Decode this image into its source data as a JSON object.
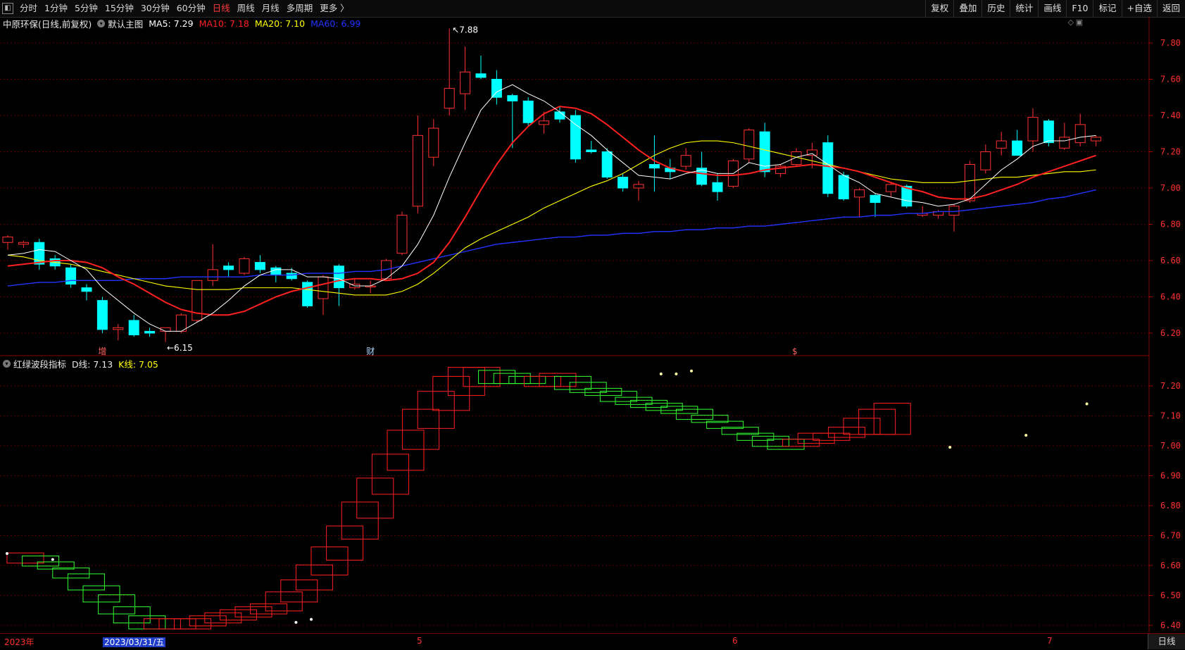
{
  "toolbar": {
    "left_icon": "panel-toggle-icon",
    "periods": [
      "分时",
      "1分钟",
      "5分钟",
      "15分钟",
      "30分钟",
      "60分钟",
      "日线",
      "周线",
      "月线",
      "多周期",
      "更多 〉"
    ],
    "active_period": "日线",
    "right_buttons": [
      "复权",
      "叠加",
      "历史",
      "统计",
      "画线",
      "F10",
      "标记",
      "+自选",
      "返回"
    ]
  },
  "main_chart": {
    "title": "中原环保(日线,前复权)",
    "indicator_name": "默认主图",
    "ma": [
      {
        "label": "MA5: 7.29",
        "color": "#ffffff"
      },
      {
        "label": "MA10: 7.18",
        "color": "#ff2020"
      },
      {
        "label": "MA20: 7.10",
        "color": "#ffff00"
      },
      {
        "label": "MA60: 6.99",
        "color": "#2233ff"
      }
    ],
    "y_ticks": [
      "7.80",
      "7.60",
      "7.40",
      "7.20",
      "7.00",
      "6.80",
      "6.60",
      "6.40",
      "6.20"
    ],
    "high_label": "7.88",
    "low_label": "6.15",
    "markers": [
      "增",
      "财",
      "$"
    ],
    "colors": {
      "up": "#ff3030",
      "down": "#00ffff"
    }
  },
  "sub_chart": {
    "name": "红绿波段指标",
    "d_label": "D线: 7.13",
    "k_label": "K线: 7.05",
    "y_ticks": [
      "7.20",
      "7.10",
      "7.00",
      "6.90",
      "6.80",
      "6.70",
      "6.60",
      "6.50",
      "6.40"
    ],
    "colors": {
      "up": "#ff2020",
      "down": "#33ff33"
    }
  },
  "bottom": {
    "dates": [
      "2023年",
      "2023/03/31/五",
      "5",
      "6",
      "7"
    ],
    "mode_button": "日线"
  },
  "chart_data": {
    "type": "candlestick",
    "days": 70,
    "candles": [
      {
        "o": 6.7,
        "h": 6.74,
        "l": 6.66,
        "c": 6.73
      },
      {
        "o": 6.69,
        "h": 6.71,
        "l": 6.67,
        "c": 6.7
      },
      {
        "o": 6.7,
        "h": 6.72,
        "l": 6.55,
        "c": 6.58
      },
      {
        "o": 6.61,
        "h": 6.63,
        "l": 6.55,
        "c": 6.57
      },
      {
        "o": 6.56,
        "h": 6.58,
        "l": 6.45,
        "c": 6.47
      },
      {
        "o": 6.45,
        "h": 6.47,
        "l": 6.38,
        "c": 6.43
      },
      {
        "o": 6.38,
        "h": 6.4,
        "l": 6.2,
        "c": 6.22
      },
      {
        "o": 6.22,
        "h": 6.25,
        "l": 6.16,
        "c": 6.23
      },
      {
        "o": 6.27,
        "h": 6.3,
        "l": 6.18,
        "c": 6.19
      },
      {
        "o": 6.21,
        "h": 6.23,
        "l": 6.18,
        "c": 6.2
      },
      {
        "o": 6.21,
        "h": 6.23,
        "l": 6.15,
        "c": 6.23
      },
      {
        "o": 6.21,
        "h": 6.31,
        "l": 6.2,
        "c": 6.3
      },
      {
        "o": 6.27,
        "h": 6.49,
        "l": 6.26,
        "c": 6.49
      },
      {
        "o": 6.49,
        "h": 6.69,
        "l": 6.46,
        "c": 6.55
      },
      {
        "o": 6.57,
        "h": 6.59,
        "l": 6.51,
        "c": 6.55
      },
      {
        "o": 6.53,
        "h": 6.62,
        "l": 6.52,
        "c": 6.61
      },
      {
        "o": 6.59,
        "h": 6.63,
        "l": 6.53,
        "c": 6.55
      },
      {
        "o": 6.56,
        "h": 6.57,
        "l": 6.48,
        "c": 6.52
      },
      {
        "o": 6.53,
        "h": 6.56,
        "l": 6.49,
        "c": 6.5
      },
      {
        "o": 6.48,
        "h": 6.49,
        "l": 6.34,
        "c": 6.35
      },
      {
        "o": 6.39,
        "h": 6.52,
        "l": 6.3,
        "c": 6.51
      },
      {
        "o": 6.57,
        "h": 6.58,
        "l": 6.35,
        "c": 6.45
      },
      {
        "o": 6.45,
        "h": 6.5,
        "l": 6.44,
        "c": 6.47
      },
      {
        "o": 6.46,
        "h": 6.49,
        "l": 6.42,
        "c": 6.46
      },
      {
        "o": 6.5,
        "h": 6.61,
        "l": 6.49,
        "c": 6.6
      },
      {
        "o": 6.64,
        "h": 6.87,
        "l": 6.63,
        "c": 6.85
      },
      {
        "o": 6.9,
        "h": 7.4,
        "l": 6.86,
        "c": 7.29
      },
      {
        "o": 7.17,
        "h": 7.38,
        "l": 7.12,
        "c": 7.33
      },
      {
        "o": 7.44,
        "h": 7.88,
        "l": 7.4,
        "c": 7.55
      },
      {
        "o": 7.52,
        "h": 7.78,
        "l": 7.43,
        "c": 7.64
      },
      {
        "o": 7.63,
        "h": 7.73,
        "l": 7.6,
        "c": 7.61
      },
      {
        "o": 7.6,
        "h": 7.65,
        "l": 7.46,
        "c": 7.5
      },
      {
        "o": 7.51,
        "h": 7.52,
        "l": 7.22,
        "c": 7.48
      },
      {
        "o": 7.48,
        "h": 7.5,
        "l": 7.34,
        "c": 7.36
      },
      {
        "o": 7.35,
        "h": 7.42,
        "l": 7.3,
        "c": 7.37
      },
      {
        "o": 7.42,
        "h": 7.45,
        "l": 7.36,
        "c": 7.38
      },
      {
        "o": 7.4,
        "h": 7.43,
        "l": 7.14,
        "c": 7.16
      },
      {
        "o": 7.21,
        "h": 7.26,
        "l": 7.19,
        "c": 7.2
      },
      {
        "o": 7.2,
        "h": 7.22,
        "l": 7.05,
        "c": 7.06
      },
      {
        "o": 7.06,
        "h": 7.08,
        "l": 6.98,
        "c": 7.0
      },
      {
        "o": 7.0,
        "h": 7.04,
        "l": 6.93,
        "c": 7.02
      },
      {
        "o": 7.13,
        "h": 7.29,
        "l": 6.98,
        "c": 7.11
      },
      {
        "o": 7.11,
        "h": 7.16,
        "l": 7.05,
        "c": 7.09
      },
      {
        "o": 7.12,
        "h": 7.22,
        "l": 7.1,
        "c": 7.18
      },
      {
        "o": 7.11,
        "h": 7.2,
        "l": 7.01,
        "c": 7.02
      },
      {
        "o": 7.03,
        "h": 7.08,
        "l": 6.93,
        "c": 6.98
      },
      {
        "o": 7.01,
        "h": 7.16,
        "l": 7.0,
        "c": 7.15
      },
      {
        "o": 7.16,
        "h": 7.33,
        "l": 7.14,
        "c": 7.32
      },
      {
        "o": 7.31,
        "h": 7.36,
        "l": 7.06,
        "c": 7.09
      },
      {
        "o": 7.08,
        "h": 7.13,
        "l": 7.06,
        "c": 7.12
      },
      {
        "o": 7.13,
        "h": 7.22,
        "l": 7.12,
        "c": 7.2
      },
      {
        "o": 7.18,
        "h": 7.25,
        "l": 7.11,
        "c": 7.21
      },
      {
        "o": 7.25,
        "h": 7.29,
        "l": 6.95,
        "c": 6.97
      },
      {
        "o": 7.07,
        "h": 7.09,
        "l": 6.93,
        "c": 6.94
      },
      {
        "o": 6.95,
        "h": 7.0,
        "l": 6.84,
        "c": 6.99
      },
      {
        "o": 6.96,
        "h": 6.97,
        "l": 6.84,
        "c": 6.92
      },
      {
        "o": 6.98,
        "h": 7.03,
        "l": 6.95,
        "c": 7.02
      },
      {
        "o": 7.01,
        "h": 7.02,
        "l": 6.89,
        "c": 6.9
      },
      {
        "o": 6.85,
        "h": 6.9,
        "l": 6.84,
        "c": 6.86
      },
      {
        "o": 6.85,
        "h": 6.88,
        "l": 6.83,
        "c": 6.87
      },
      {
        "o": 6.85,
        "h": 6.91,
        "l": 6.76,
        "c": 6.9
      },
      {
        "o": 6.93,
        "h": 7.15,
        "l": 6.92,
        "c": 7.13
      },
      {
        "o": 7.1,
        "h": 7.24,
        "l": 7.08,
        "c": 7.2
      },
      {
        "o": 7.22,
        "h": 7.31,
        "l": 7.18,
        "c": 7.26
      },
      {
        "o": 7.26,
        "h": 7.32,
        "l": 7.2,
        "c": 7.18
      },
      {
        "o": 7.26,
        "h": 7.44,
        "l": 7.2,
        "c": 7.39
      },
      {
        "o": 7.37,
        "h": 7.38,
        "l": 7.23,
        "c": 7.25
      },
      {
        "o": 7.22,
        "h": 7.36,
        "l": 7.21,
        "c": 7.28
      },
      {
        "o": 7.25,
        "h": 7.41,
        "l": 7.23,
        "c": 7.35
      },
      {
        "o": 7.26,
        "h": 7.29,
        "l": 7.23,
        "c": 7.28
      }
    ],
    "ma5": [
      6.63,
      6.64,
      6.66,
      6.65,
      6.6,
      6.55,
      6.45,
      6.38,
      6.31,
      6.25,
      6.21,
      6.21,
      6.26,
      6.31,
      6.38,
      6.46,
      6.52,
      6.55,
      6.55,
      6.51,
      6.51,
      6.5,
      6.46,
      6.46,
      6.5,
      6.57,
      6.69,
      6.85,
      7.06,
      7.25,
      7.43,
      7.53,
      7.57,
      7.52,
      7.48,
      7.42,
      7.35,
      7.29,
      7.21,
      7.14,
      7.07,
      7.06,
      7.05,
      7.08,
      7.1,
      7.08,
      7.08,
      7.14,
      7.12,
      7.13,
      7.17,
      7.19,
      7.13,
      7.07,
      7.03,
      6.97,
      6.95,
      6.93,
      6.92,
      6.9,
      6.91,
      6.94,
      7.02,
      7.1,
      7.16,
      7.23,
      7.26,
      7.26,
      7.28,
      7.29
    ],
    "ma10": [
      6.57,
      6.58,
      6.59,
      6.6,
      6.6,
      6.59,
      6.56,
      6.51,
      6.47,
      6.42,
      6.37,
      6.33,
      6.31,
      6.3,
      6.3,
      6.32,
      6.36,
      6.4,
      6.43,
      6.45,
      6.47,
      6.49,
      6.5,
      6.5,
      6.49,
      6.5,
      6.53,
      6.59,
      6.7,
      6.84,
      6.99,
      7.13,
      7.25,
      7.34,
      7.41,
      7.45,
      7.44,
      7.41,
      7.35,
      7.28,
      7.21,
      7.15,
      7.11,
      7.09,
      7.08,
      7.07,
      7.07,
      7.08,
      7.1,
      7.11,
      7.12,
      7.13,
      7.12,
      7.11,
      7.09,
      7.06,
      7.03,
      7.0,
      6.98,
      6.95,
      6.94,
      6.94,
      6.96,
      6.99,
      7.02,
      7.06,
      7.09,
      7.12,
      7.15,
      7.18
    ],
    "ma20": [
      6.63,
      6.62,
      6.6,
      6.59,
      6.58,
      6.56,
      6.54,
      6.52,
      6.5,
      6.48,
      6.46,
      6.45,
      6.44,
      6.44,
      6.44,
      6.45,
      6.45,
      6.45,
      6.45,
      6.44,
      6.43,
      6.42,
      6.41,
      6.41,
      6.41,
      6.43,
      6.47,
      6.53,
      6.6,
      6.67,
      6.72,
      6.76,
      6.8,
      6.84,
      6.89,
      6.93,
      6.97,
      7.01,
      7.04,
      7.08,
      7.13,
      7.18,
      7.22,
      7.25,
      7.26,
      7.26,
      7.25,
      7.23,
      7.21,
      7.19,
      7.17,
      7.15,
      7.13,
      7.11,
      7.09,
      7.07,
      7.05,
      7.04,
      7.03,
      7.03,
      7.03,
      7.04,
      7.05,
      7.06,
      7.06,
      7.07,
      7.08,
      7.09,
      7.09,
      7.1
    ],
    "ma60": [
      6.46,
      6.47,
      6.48,
      6.48,
      6.49,
      6.49,
      6.49,
      6.49,
      6.5,
      6.5,
      6.5,
      6.51,
      6.51,
      6.51,
      6.51,
      6.51,
      6.52,
      6.52,
      6.52,
      6.53,
      6.53,
      6.53,
      6.54,
      6.54,
      6.55,
      6.57,
      6.59,
      6.61,
      6.63,
      6.65,
      6.67,
      6.69,
      6.7,
      6.71,
      6.72,
      6.73,
      6.73,
      6.74,
      6.74,
      6.75,
      6.75,
      6.76,
      6.76,
      6.77,
      6.77,
      6.78,
      6.78,
      6.79,
      6.79,
      6.8,
      6.81,
      6.82,
      6.83,
      6.84,
      6.84,
      6.85,
      6.85,
      6.86,
      6.86,
      6.87,
      6.87,
      6.88,
      6.89,
      6.9,
      6.91,
      6.92,
      6.94,
      6.95,
      6.97,
      6.99
    ],
    "band_d": [
      6.63,
      6.62,
      6.6,
      6.57,
      6.53,
      6.49,
      6.45,
      6.42,
      6.4,
      6.4,
      6.41,
      6.41,
      6.42,
      6.43,
      6.44,
      6.45,
      6.46,
      6.5,
      6.54,
      6.59,
      6.65,
      6.72,
      6.8,
      6.88,
      6.96,
      7.04,
      7.11,
      7.17,
      7.22,
      7.25,
      7.25,
      7.24,
      7.23,
      7.22,
      7.22,
      7.23,
      7.22,
      7.2,
      7.18,
      7.17,
      7.15,
      7.14,
      7.13,
      7.12,
      7.11,
      7.09,
      7.07,
      7.05,
      7.03,
      7.01,
      7.0,
      7.01,
      7.03,
      7.03,
      7.05,
      7.08,
      7.11,
      7.13
    ],
    "band_k": [
      6.62,
      6.61,
      6.6,
      6.58,
      6.56,
      6.52,
      6.49,
      6.45,
      6.42,
      6.41,
      6.4,
      6.4,
      6.41,
      6.42,
      6.43,
      6.44,
      6.45,
      6.46,
      6.49,
      6.53,
      6.58,
      6.63,
      6.7,
      6.77,
      6.85,
      6.93,
      7.0,
      7.07,
      7.13,
      7.18,
      7.21,
      7.22,
      7.22,
      7.22,
      7.21,
      7.21,
      7.2,
      7.19,
      7.18,
      7.16,
      7.15,
      7.14,
      7.13,
      7.12,
      7.1,
      7.09,
      7.07,
      7.05,
      7.03,
      7.02,
      7.01,
      7.01,
      7.02,
      7.03,
      7.04,
      7.05,
      7.05,
      7.05
    ]
  }
}
